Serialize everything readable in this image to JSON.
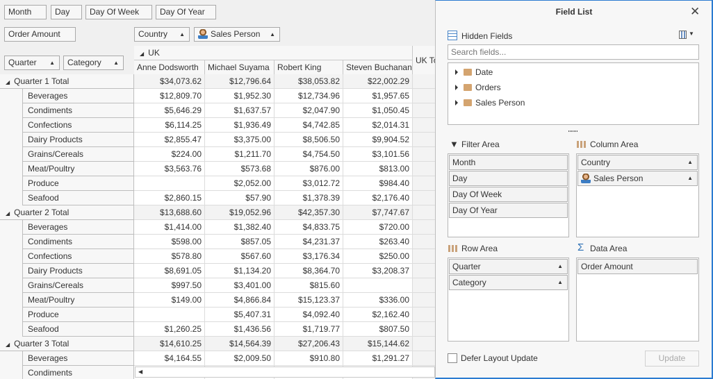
{
  "filter_header": {
    "fields": [
      "Month",
      "Day",
      "Day Of Week",
      "Day Of Year"
    ]
  },
  "data_header": {
    "fields": [
      "Order Amount"
    ]
  },
  "column_header": {
    "fields": [
      "Country",
      "Sales Person"
    ]
  },
  "row_header": {
    "fields": [
      "Quarter",
      "Category"
    ]
  },
  "grid": {
    "country": "UK",
    "total_label": "UK Total",
    "columns": [
      "Anne Dodsworth",
      "Michael Suyama",
      "Robert King",
      "Steven Buchanan"
    ],
    "rows": [
      {
        "label": "Quarter 1 Total",
        "total": true,
        "values": [
          "$34,073.62",
          "$12,796.64",
          "$38,053.82",
          "$22,002.29"
        ]
      },
      {
        "label": "Beverages",
        "values": [
          "$12,809.70",
          "$1,952.30",
          "$12,734.96",
          "$1,957.65"
        ]
      },
      {
        "label": "Condiments",
        "values": [
          "$5,646.29",
          "$1,637.57",
          "$2,047.90",
          "$1,050.45"
        ]
      },
      {
        "label": "Confections",
        "values": [
          "$6,114.25",
          "$1,936.49",
          "$4,742.85",
          "$2,014.31"
        ]
      },
      {
        "label": "Dairy Products",
        "values": [
          "$2,855.47",
          "$3,375.00",
          "$8,506.50",
          "$9,904.52"
        ]
      },
      {
        "label": "Grains/Cereals",
        "values": [
          "$224.00",
          "$1,211.70",
          "$4,754.50",
          "$3,101.56"
        ]
      },
      {
        "label": "Meat/Poultry",
        "values": [
          "$3,563.76",
          "$573.68",
          "$876.00",
          "$813.00"
        ]
      },
      {
        "label": "Produce",
        "values": [
          "",
          "$2,052.00",
          "$3,012.72",
          "$984.40"
        ]
      },
      {
        "label": "Seafood",
        "values": [
          "$2,860.15",
          "$57.90",
          "$1,378.39",
          "$2,176.40"
        ]
      },
      {
        "label": "Quarter 2 Total",
        "total": true,
        "values": [
          "$13,688.60",
          "$19,052.96",
          "$42,357.30",
          "$7,747.67"
        ]
      },
      {
        "label": "Beverages",
        "values": [
          "$1,414.00",
          "$1,382.40",
          "$4,833.75",
          "$720.00"
        ]
      },
      {
        "label": "Condiments",
        "values": [
          "$598.00",
          "$857.05",
          "$4,231.37",
          "$263.40"
        ]
      },
      {
        "label": "Confections",
        "values": [
          "$578.80",
          "$567.60",
          "$3,176.34",
          "$250.00"
        ]
      },
      {
        "label": "Dairy Products",
        "values": [
          "$8,691.05",
          "$1,134.20",
          "$8,364.70",
          "$3,208.37"
        ]
      },
      {
        "label": "Grains/Cereals",
        "values": [
          "$997.50",
          "$3,401.00",
          "$815.60",
          ""
        ]
      },
      {
        "label": "Meat/Poultry",
        "values": [
          "$149.00",
          "$4,866.84",
          "$15,123.37",
          "$336.00"
        ]
      },
      {
        "label": "Produce",
        "values": [
          "",
          "$5,407.31",
          "$4,092.40",
          "$2,162.40"
        ]
      },
      {
        "label": "Seafood",
        "values": [
          "$1,260.25",
          "$1,436.56",
          "$1,719.77",
          "$807.50"
        ]
      },
      {
        "label": "Quarter 3 Total",
        "total": true,
        "values": [
          "$14,610.25",
          "$14,564.39",
          "$27,206.43",
          "$15,144.62"
        ]
      },
      {
        "label": "Beverages",
        "values": [
          "$4,164.55",
          "$2,009.50",
          "$910.80",
          "$1,291.27"
        ]
      },
      {
        "label": "Condiments",
        "values": [
          "",
          "",
          "",
          ""
        ]
      }
    ]
  },
  "field_list": {
    "title": "Field List",
    "hidden_fields_label": "Hidden Fields",
    "search_placeholder": "Search fields...",
    "tree": [
      "Date",
      "Orders",
      "Sales Person"
    ],
    "filter_area": {
      "label": "Filter Area",
      "items": [
        "Month",
        "Day",
        "Day Of Week",
        "Day Of Year"
      ]
    },
    "column_area": {
      "label": "Column Area",
      "items": [
        "Country",
        "Sales Person"
      ]
    },
    "row_area": {
      "label": "Row Area",
      "items": [
        "Quarter",
        "Category"
      ]
    },
    "data_area": {
      "label": "Data Area",
      "items": [
        "Order Amount"
      ]
    },
    "defer_label": "Defer Layout Update",
    "defer_checked": false,
    "update_label": "Update"
  },
  "colors": {
    "accent": "#2b7bd1",
    "folder": "#d4a46f"
  }
}
